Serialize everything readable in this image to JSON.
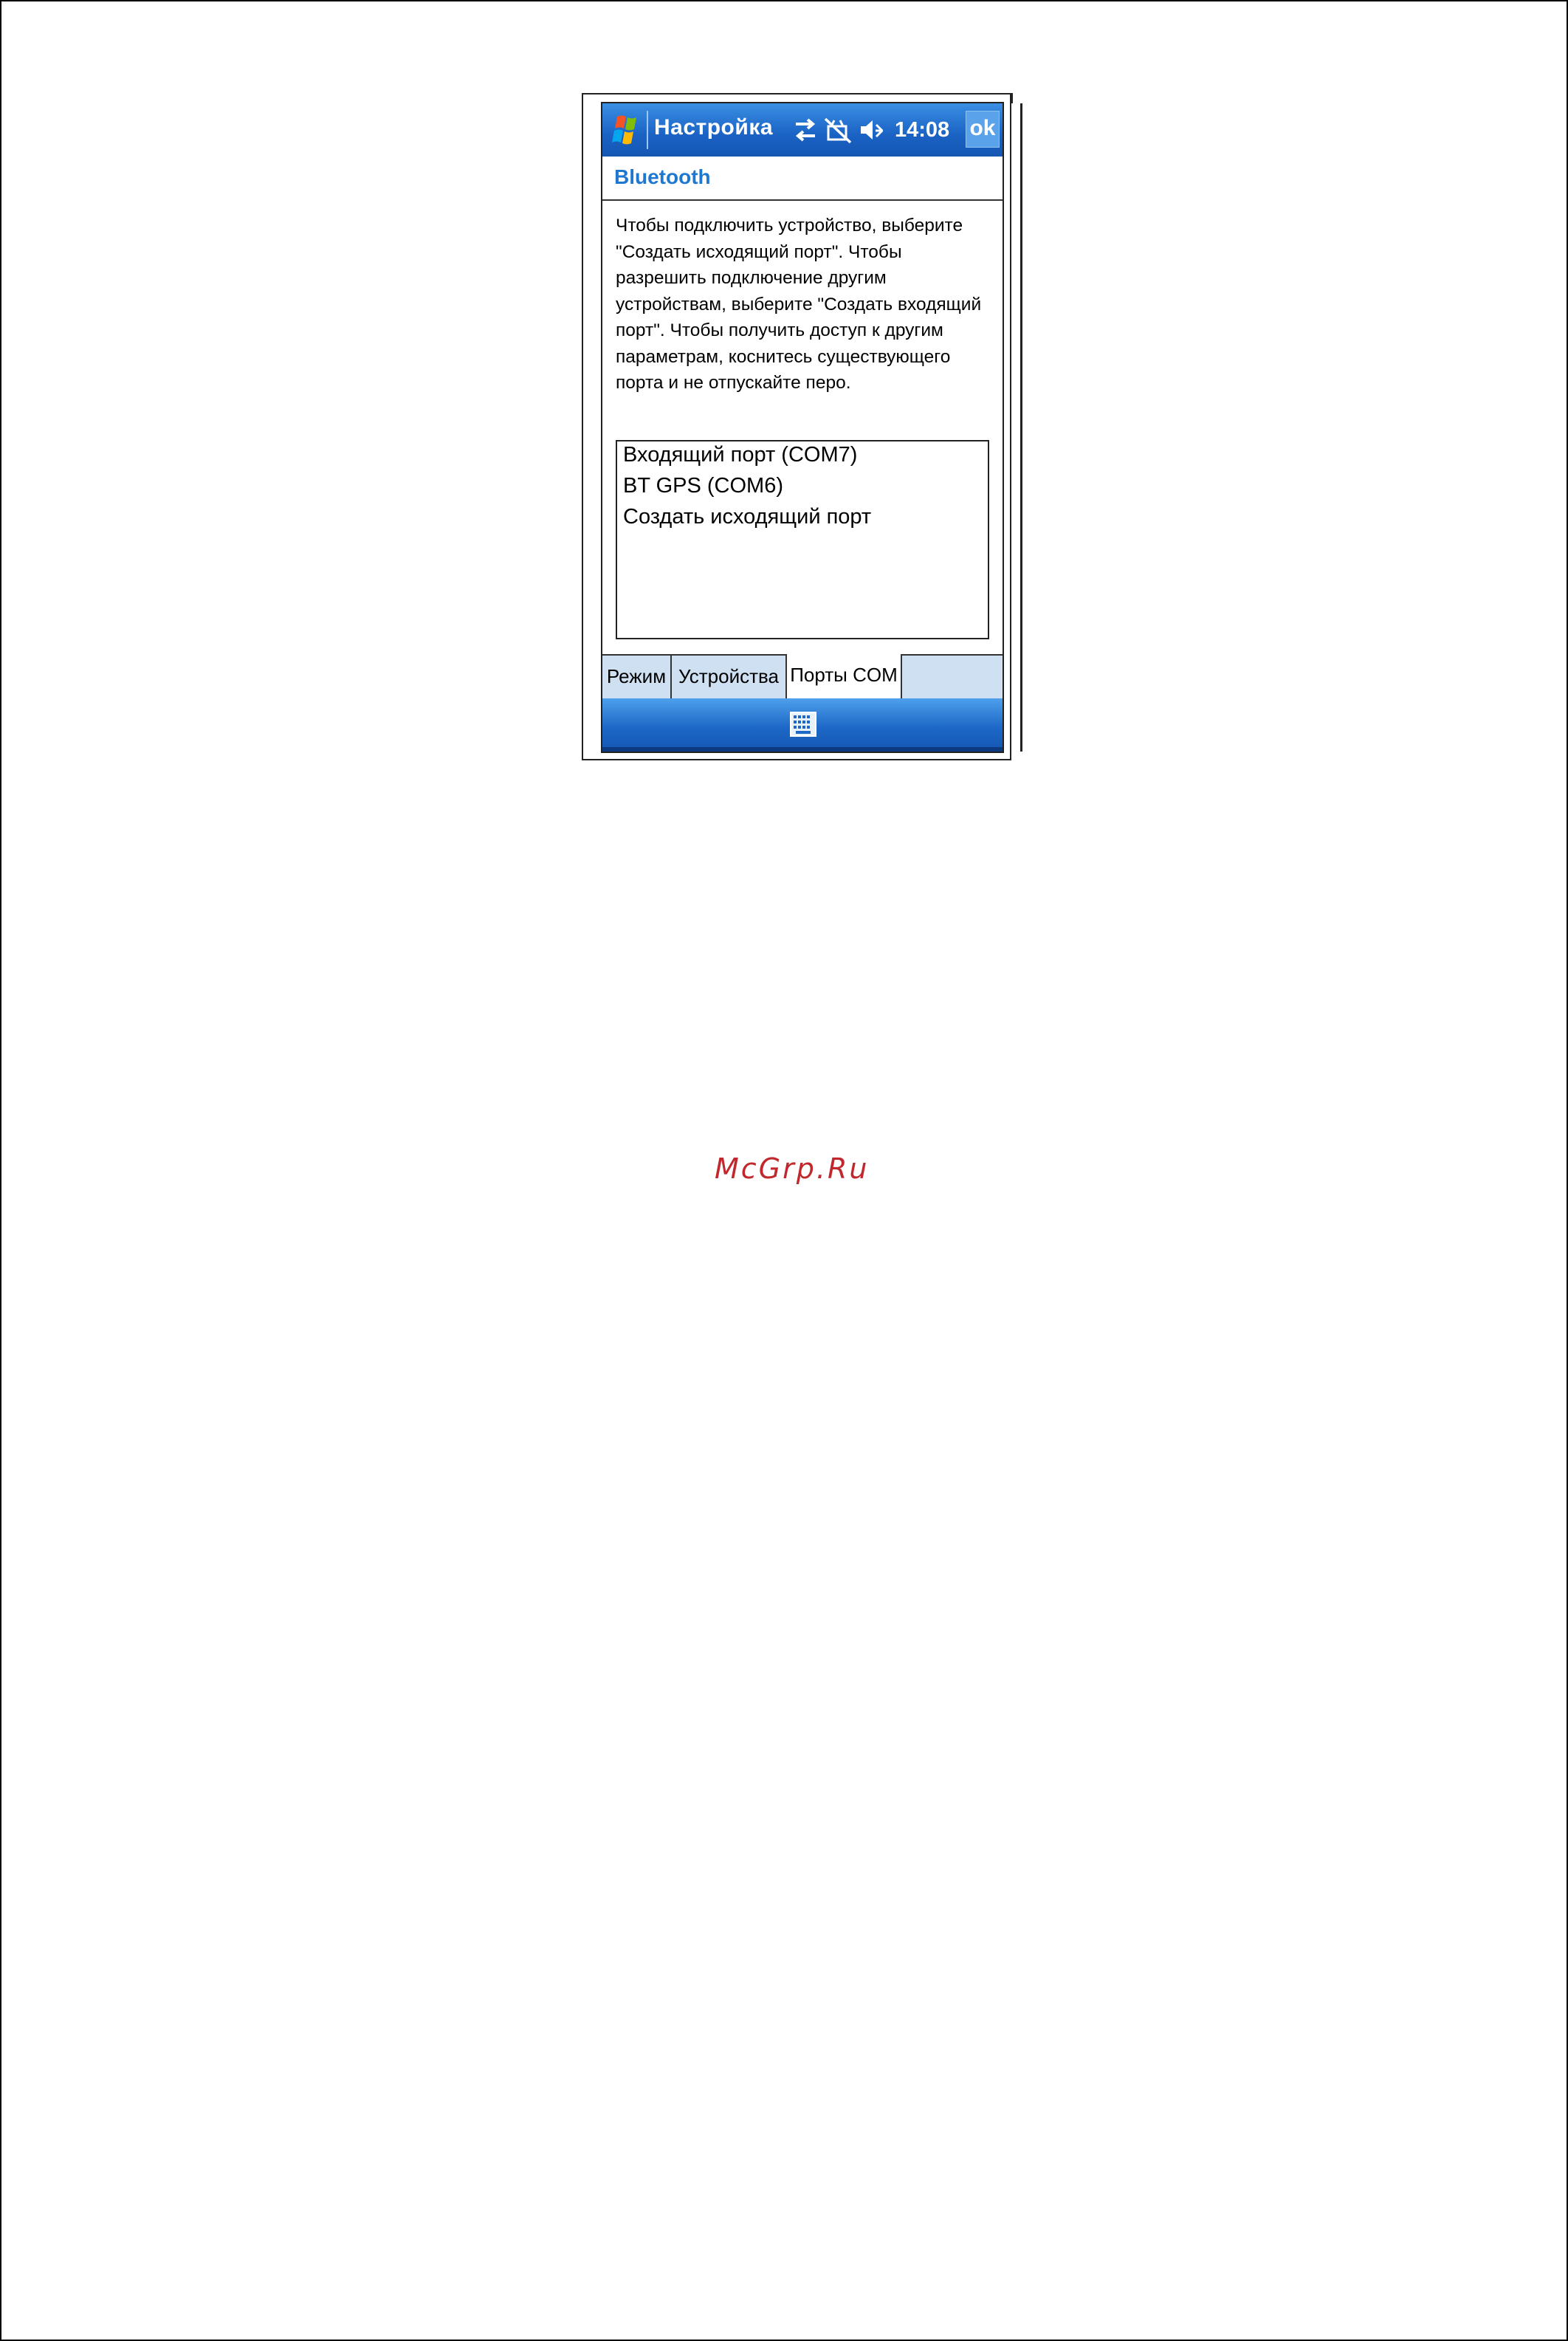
{
  "window": {
    "title": "Настройка",
    "time": "14:08",
    "ok_label": "ok",
    "status_icons": [
      "connectivity-icon",
      "signal-off-icon",
      "volume-mute-icon"
    ]
  },
  "screen": {
    "heading": "Bluetooth",
    "description": "Чтобы подключить устройство, выберите \"Создать исходящий порт\". Чтобы разрешить подключение другим устройствам, выберите \"Создать входящий порт\". Чтобы получить доступ к другим параметрам, коснитесь существующего порта и не отпускайте перо.",
    "ports": [
      "Входящий порт (COM7)",
      "BT GPS (COM6)",
      "Создать исходящий порт"
    ]
  },
  "tabs": [
    {
      "label": "Режим",
      "active": false
    },
    {
      "label": "Устройства",
      "active": false
    },
    {
      "label": "Порты COM",
      "active": true
    }
  ],
  "menubar": {
    "icon": "keyboard-icon"
  },
  "watermark": "McGrp.Ru",
  "colors": {
    "titlebar": "#1a62c4",
    "heading": "#1f78d0",
    "tabbar": "#cfe0f2",
    "watermark": "#c0282d"
  }
}
